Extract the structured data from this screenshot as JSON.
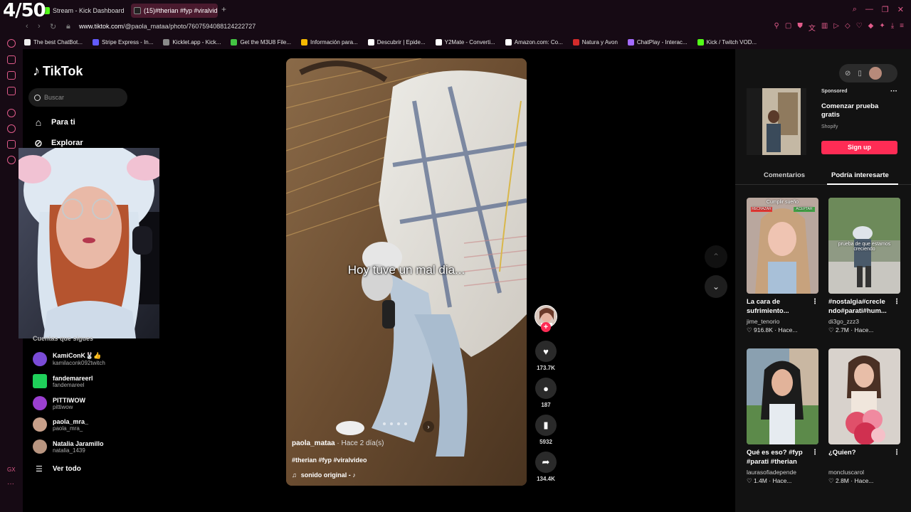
{
  "overlay": {
    "counter": "4/50"
  },
  "browser": {
    "tabs": [
      {
        "label": "Stream - Kick Dashboard"
      },
      {
        "label": "(15)#therian #fyp #viralvid"
      }
    ],
    "new_tab": "+",
    "url_host": "www.tiktok.com",
    "url_path": "/@paola_mataa/photo/7607594088124222727",
    "bookmarks": [
      {
        "label": "The best ChatBot...",
        "color": "#eeeeee"
      },
      {
        "label": "Stripe Express - In...",
        "color": "#635bff"
      },
      {
        "label": "Kicklet.app - Kick...",
        "color": "#8a8a8a"
      },
      {
        "label": "Get the M3U8 File...",
        "color": "#43c443"
      },
      {
        "label": "Información para...",
        "color": "#f5b800"
      },
      {
        "label": "Descubrir | Epide...",
        "color": "#ffffff"
      },
      {
        "label": "Y2Mate - Converti...",
        "color": "#ffffff"
      },
      {
        "label": "Amazon.com: Co...",
        "color": "#ffffff"
      },
      {
        "label": "Natura y Avon",
        "color": "#d42b2b"
      },
      {
        "label": "ChatPlay - Interac...",
        "color": "#a46bff"
      },
      {
        "label": "Kick / Twitch VOD...",
        "color": "#53fc18"
      }
    ],
    "sidebar_label": "GX"
  },
  "tiktok": {
    "logo": "TikTok",
    "search_placeholder": "Buscar",
    "nav": [
      {
        "label": "Para ti",
        "icon": "home-icon"
      },
      {
        "label": "Explorar",
        "icon": "compass-icon"
      }
    ],
    "following_heading": "Cuentas que sigues",
    "following": [
      {
        "name": "KamiConK🐰👍",
        "handle": "kamilaconk092twitch",
        "color": "#7a4bd6"
      },
      {
        "name": "fandemareerl",
        "handle": "fandemareel",
        "color": "#1fd05a"
      },
      {
        "name": "PITTIWOW",
        "handle": "pittiwow",
        "color": "#9b3fd1"
      },
      {
        "name": "paola_mra_",
        "handle": "paola_mra_",
        "color": "#c8a08a"
      },
      {
        "name": "Natalia Jaramillo",
        "handle": "natalia_1439",
        "color": "#b89580"
      }
    ],
    "see_all": "Ver todo",
    "video": {
      "caption": "Hoy tuve un mal dia...",
      "author": "paola_mataa",
      "time": " · Hace 2 día(s)",
      "tags": "#therian #fyp #viralvideo",
      "sound": "sonido original - ♪",
      "likes": "173.7K",
      "comments": "187",
      "saves": "5932",
      "shares": "134.4K"
    },
    "ad": {
      "sponsored": "Sponsored",
      "title": "Comenzar prueba gratis",
      "sponsor": "Shopify",
      "cta": "Sign up"
    },
    "right_tabs": {
      "comments": "Comentarios",
      "maybe": "Podría interesarte"
    },
    "cards": [
      {
        "title": "La cara de sufrimiento...",
        "author": "jime_tenorio",
        "likes": "916.8K",
        "ago": "Hace...",
        "overlay": "Cumplir sueño"
      },
      {
        "title": "#nostalgia#crecle ndo#parati#hum...",
        "author": "di3go_zzz3",
        "likes": "2.7M",
        "ago": "Hace...",
        "overlay": "prueba de que estamos creciendo"
      },
      {
        "title": "Qué es eso? #fyp #parati #therian",
        "author": "laurasofiadepende",
        "likes": "1.4M",
        "ago": "Hace..."
      },
      {
        "title": "¿Quien?",
        "author": "moncluscarol",
        "likes": "2.8M",
        "ago": "Hace..."
      }
    ],
    "tag_rechazar": "RECHAZAR",
    "tag_aceptar": "ACEPTAR"
  }
}
